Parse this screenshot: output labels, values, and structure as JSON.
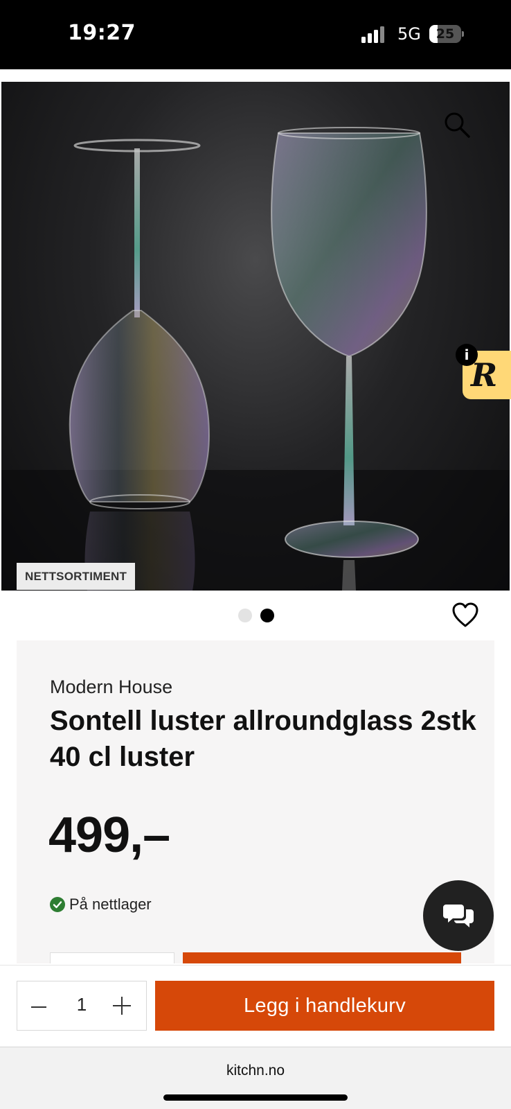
{
  "status_bar": {
    "time": "19:27",
    "network": "5G",
    "battery_level": "25",
    "battery_fraction": 0.25
  },
  "product": {
    "image_badge": "NETTSORTIMENT",
    "image_count": 2,
    "active_image_index": 1,
    "brand": "Modern House",
    "title": "Sontell luster allroundglass 2stk 40 cl luster",
    "price": "499,–",
    "stock_status": "På nettlager",
    "stock_icon": "check-circle-icon",
    "stock_color": "#2e7d32"
  },
  "icons": {
    "zoom": "search-icon",
    "favorite": "heart-icon",
    "chat": "chat-bubbles-icon",
    "info": "info-icon",
    "reward": "r-logo"
  },
  "r_tab": {
    "letter": "R",
    "info": "i"
  },
  "purchase_bar": {
    "quantity": "1",
    "add_to_cart_label": "Legg i handlekurv"
  },
  "browser": {
    "url": "kitchn.no"
  },
  "colors": {
    "accent": "#d64809",
    "reward_tab": "#ffd877",
    "chat_button": "#212121"
  }
}
